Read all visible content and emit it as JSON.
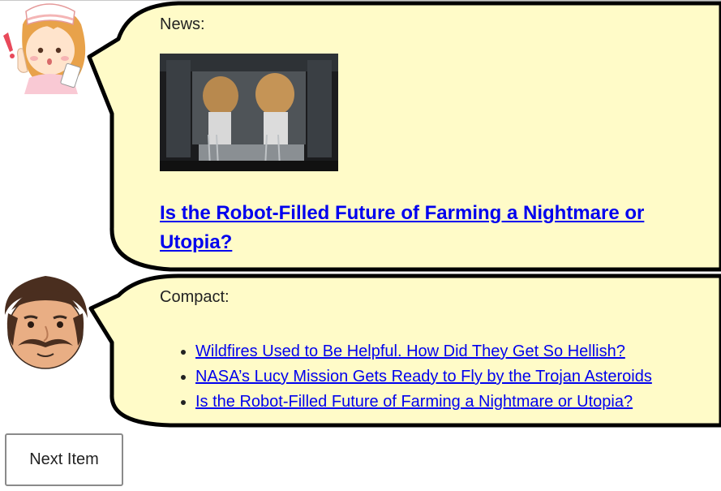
{
  "news": {
    "label": "News:",
    "photo_alt": "robotic farm equipment",
    "headline": "Is the Robot-Filled Future of Farming a Nightmare or Utopia?"
  },
  "compact": {
    "label": "Compact:",
    "items": [
      "Wildfires Used to Be Helpful. How Did They Get So Hellish?",
      "NASA’s Lucy Mission Gets Ready to Fly by the Trojan Asteroids",
      "Is the Robot-Filled Future of Farming a Nightmare or Utopia?"
    ]
  },
  "next_button": {
    "label": "Next Item"
  },
  "colors": {
    "bubble_fill": "#fffbc8",
    "bubble_stroke": "#000000",
    "link": "#0000ee"
  }
}
